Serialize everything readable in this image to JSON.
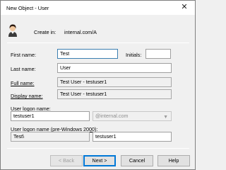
{
  "window": {
    "title": "New Object - User",
    "close_glyph": "✕"
  },
  "header": {
    "icon": "user-avatar-icon",
    "create_in_label": "Create in:",
    "create_in_value": "internal.com/A"
  },
  "form": {
    "first_name": {
      "label": "First name:",
      "value": "Test"
    },
    "initials": {
      "label": "Initials:",
      "value": ""
    },
    "last_name": {
      "label": "Last name:",
      "value": "User"
    },
    "full_name": {
      "label": "Full name:",
      "value": "Test User - testuser1"
    },
    "display_name": {
      "label": "Display name:",
      "value": "Test User - testuser1"
    },
    "logon_name": {
      "label": "User logon name:",
      "value": "testuser1",
      "domain": "@internal.com"
    },
    "pre2000": {
      "label": "User logon name (pre-Windows 2000):",
      "prefix": "Test\\",
      "value": "testuser1"
    }
  },
  "buttons": {
    "back": "< Back",
    "next": "Next >",
    "cancel": "Cancel",
    "help": "Help"
  }
}
